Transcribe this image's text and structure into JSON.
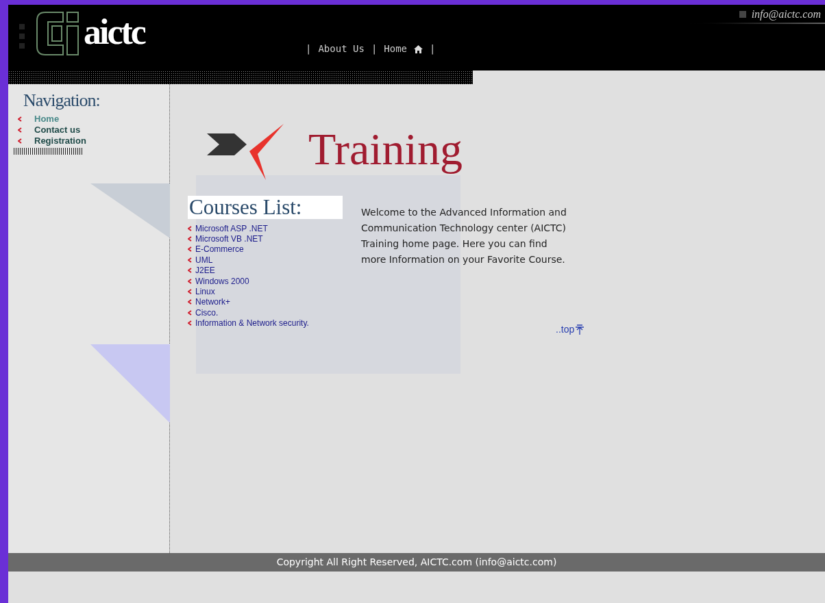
{
  "header": {
    "logo_text": "aictc",
    "email": "info@aictc.com",
    "nav": [
      {
        "label": "|",
        "kind": "separator"
      },
      {
        "label": "About Us",
        "kind": "text"
      },
      {
        "label": "|",
        "kind": "separator"
      },
      {
        "label": "Home",
        "kind": "home"
      },
      {
        "label": "|",
        "kind": "separator"
      }
    ]
  },
  "sidebar": {
    "title": "Navigation:",
    "items": [
      {
        "label": "Home",
        "selected": true
      },
      {
        "label": "Contact us",
        "selected": false
      },
      {
        "label": "Registration",
        "selected": false
      }
    ]
  },
  "banner": {
    "title": "Training"
  },
  "courses": {
    "title": "Courses List:",
    "items": [
      "Microsoft ASP .NET",
      "Microsoft VB .NET",
      "E-Commerce",
      "UML",
      "J2EE",
      "Windows 2000",
      "Linux",
      "Network+",
      "Cisco.",
      "Information & Network security."
    ]
  },
  "welcome": "Welcome to the Advanced Information and Communication Technology center (AICTC) Training home page. Here you can find more Information on your Favorite Course.",
  "top_link": "..top",
  "footer": "Copyright All Right Reserved, AICTC.com (info@aictc.com)"
}
